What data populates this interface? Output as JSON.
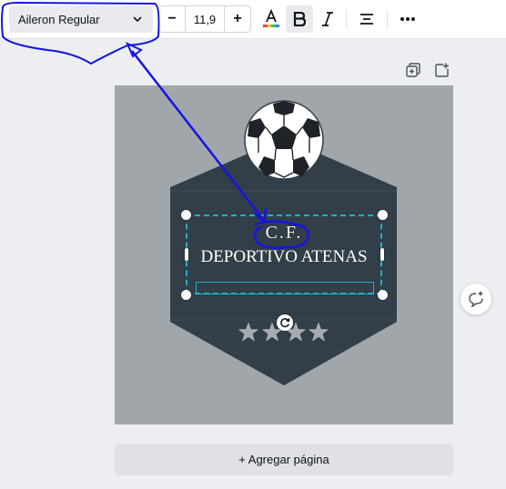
{
  "toolbar": {
    "font_name": "Aileron Regular",
    "font_size": "11,9",
    "decrease_label": "−",
    "increase_label": "+"
  },
  "canvas": {
    "title_line1": "C.F.",
    "title_line2": "DEPORTIVO ATENAS"
  },
  "add_page_label": "+ Agregar página",
  "colors": {
    "badge": "#323e48",
    "canvas_bg": "#a1a6aa",
    "selection": "#21b1c6",
    "annotation": "#1414e6",
    "star": "#a7abb0"
  },
  "icons": [
    "chevron-down-icon",
    "text-color-icon",
    "bold-icon",
    "italic-icon",
    "align-center-icon",
    "more-icon",
    "duplicate-page-icon",
    "add-page-icon",
    "soccer-ball-icon",
    "star-icon",
    "rotate-icon",
    "comment-icon"
  ]
}
